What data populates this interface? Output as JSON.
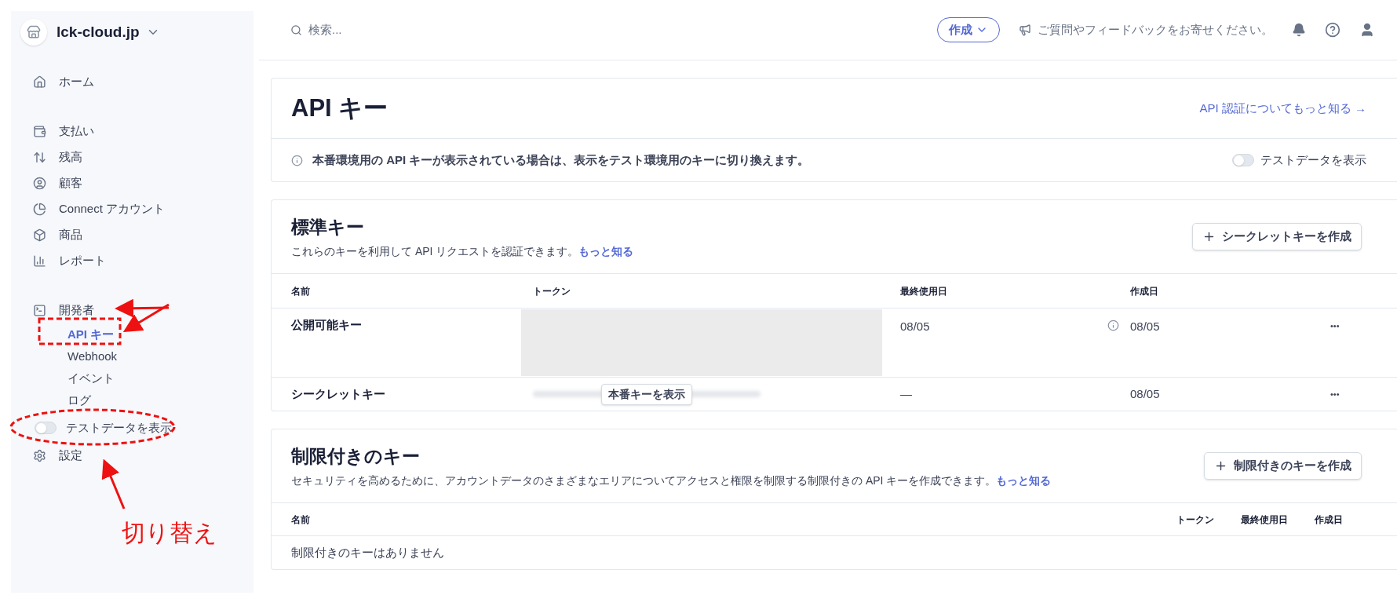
{
  "sidebar": {
    "account": "lck-cloud.jp",
    "sections": [
      {
        "items": [
          {
            "label": "ホーム",
            "kind": "nav"
          }
        ]
      },
      {
        "items": [
          {
            "label": "支払い",
            "kind": "nav"
          },
          {
            "label": "残高",
            "kind": "nav"
          },
          {
            "label": "顧客",
            "kind": "nav"
          },
          {
            "label": "Connect アカウント",
            "kind": "nav"
          },
          {
            "label": "商品",
            "kind": "nav"
          },
          {
            "label": "レポート",
            "kind": "nav"
          }
        ]
      },
      {
        "items": [
          {
            "label": "開発者",
            "kind": "nav",
            "children": [
              {
                "label": "API キー",
                "selected": true
              },
              {
                "label": "Webhook",
                "selected": false
              },
              {
                "label": "イベント",
                "selected": false
              },
              {
                "label": "ログ",
                "selected": false
              }
            ]
          },
          {
            "label": "テストデータを表示",
            "kind": "toggle",
            "on": false
          },
          {
            "label": "設定",
            "kind": "nav"
          }
        ]
      }
    ]
  },
  "topbar": {
    "search": {
      "placeholder": "検索..."
    },
    "create_button": "作成",
    "feedback": "ご質問やフィードバックをお寄せください。"
  },
  "header": {
    "title": "API キー",
    "link": "API 認証についてもっと知る →",
    "notice": "本番環境用の API キーが表示されている場合は、表示をテスト環境用のキーに切り換えます。",
    "toggle": {
      "label": "テストデータを表示",
      "on": false
    }
  },
  "standard_keys": {
    "title": "標準キー",
    "description": "これらのキーを利用して API リクエストを認証できます。",
    "link": "もっと知る",
    "button": "シークレットキーを作成",
    "columns": [
      "名前",
      "トークン",
      "最終使用日",
      "作成日"
    ],
    "rows": [
      {
        "name": "公開可能キー",
        "kind": "redacted",
        "last_used": "08/05",
        "info": true,
        "created": "08/05",
        "menu": "•••"
      },
      {
        "name": "シークレットキー",
        "kind": "reveal",
        "reveal_button": "本番キーを表示",
        "last_used": "—",
        "info": false,
        "created": "08/05",
        "menu": "•••"
      }
    ]
  },
  "restricted_keys": {
    "title": "制限付きのキー",
    "description": "セキュリティを高めるために、アカウントデータのさまざまなエリアについてアクセスと権限を制限する制限付きの API キーを作成できます。",
    "link": "もっと知る",
    "button": "制限付きのキーを作成",
    "columns": [
      "名前",
      "トークン",
      "最終使用日",
      "作成日"
    ],
    "empty": "制限付きのキーはありません"
  },
  "annotation": {
    "label": "切り替え"
  }
}
